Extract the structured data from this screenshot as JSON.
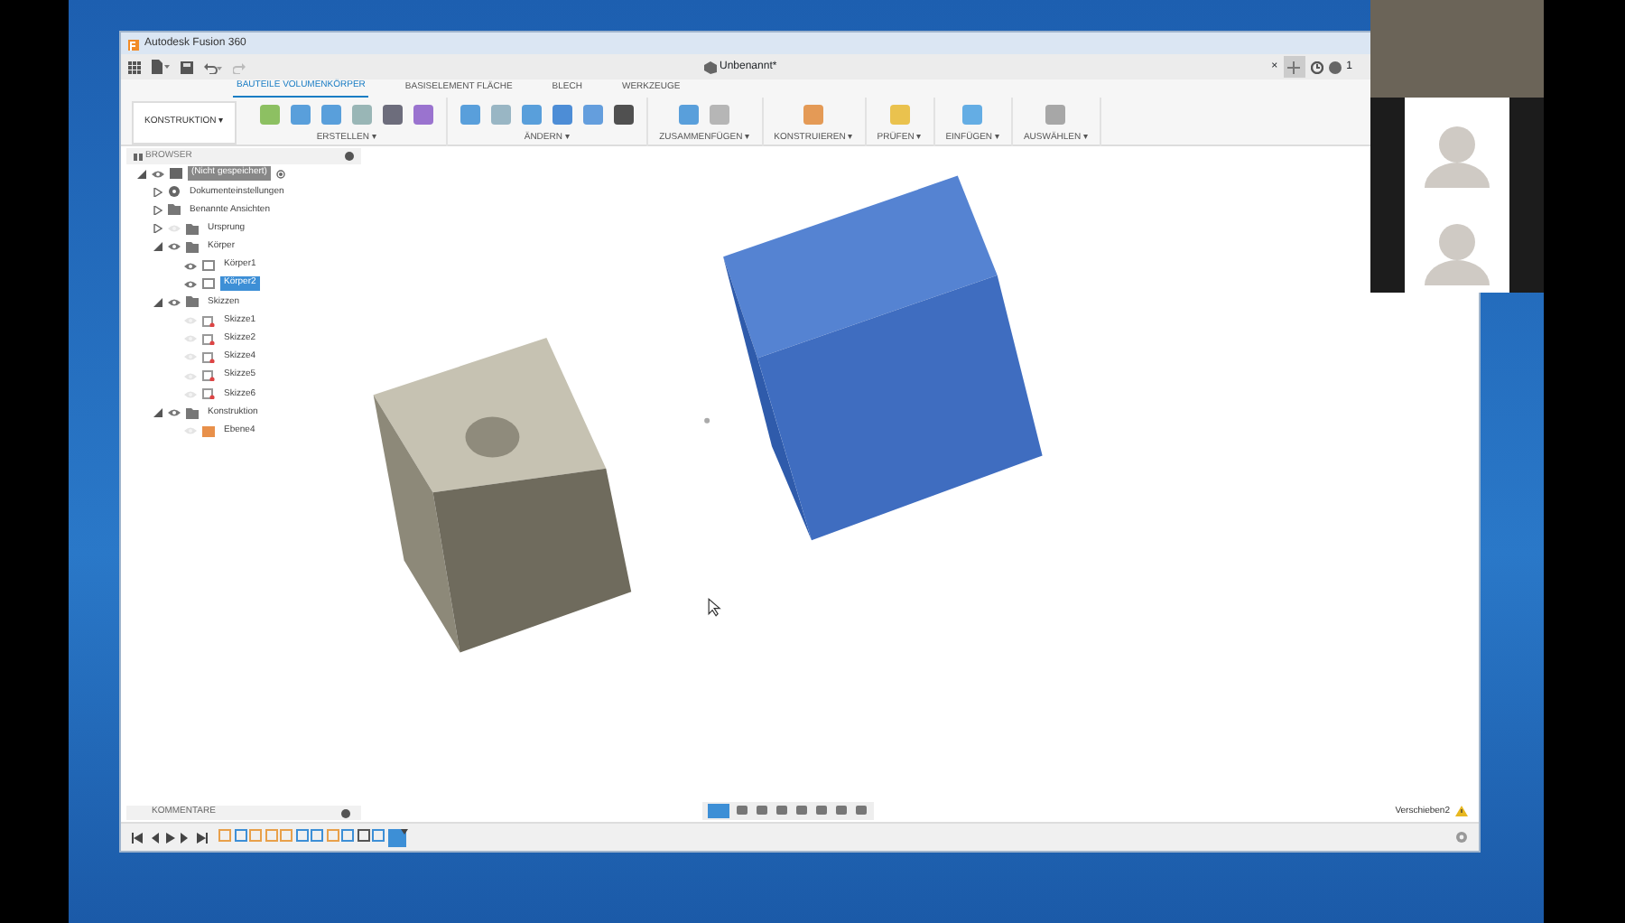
{
  "window": {
    "title": "Autodesk Fusion 360"
  },
  "document": {
    "title": "Unbenannt*",
    "close": "×",
    "notifications": "1"
  },
  "workspace": {
    "label": "KONSTRUKTION ▾"
  },
  "tabs": [
    {
      "label": "BAUTEILE VOLUMENKÖRPER",
      "selected": true
    },
    {
      "label": "BASISELEMENT FLÄCHE",
      "selected": false
    },
    {
      "label": "BLECH",
      "selected": false
    },
    {
      "label": "WERKZEUGE",
      "selected": false
    }
  ],
  "tool_groups": [
    {
      "label": "ERSTELLEN ▾"
    },
    {
      "label": "ÄNDERN ▾"
    },
    {
      "label": "ZUSAMMENFÜGEN ▾"
    },
    {
      "label": "KONSTRUIEREN ▾"
    },
    {
      "label": "PRÜFEN ▾"
    },
    {
      "label": "EINFÜGEN ▾"
    },
    {
      "label": "AUSWÄHLEN ▾"
    }
  ],
  "browser": {
    "title": "BROWSER",
    "tree": [
      {
        "label": "(Nicht gespeichert)",
        "kind": "component",
        "visible": true,
        "expanded": true,
        "selected": false,
        "children": [
          {
            "label": "Dokumenteinstellungen",
            "kind": "settings",
            "expanded": false,
            "selected": false
          },
          {
            "label": "Benannte Ansichten",
            "kind": "folder",
            "expanded": false,
            "selected": false
          },
          {
            "label": "Ursprung",
            "kind": "folder",
            "visible": false,
            "expanded": false,
            "selected": false
          },
          {
            "label": "Körper",
            "kind": "folder",
            "visible": true,
            "expanded": true,
            "selected": false,
            "children": [
              {
                "label": "Körper1",
                "kind": "body",
                "visible": true,
                "selected": false
              },
              {
                "label": "Körper2",
                "kind": "body",
                "visible": true,
                "selected": true
              }
            ]
          },
          {
            "label": "Skizzen",
            "kind": "folder",
            "visible": true,
            "expanded": true,
            "selected": false,
            "children": [
              {
                "label": "Skizze1",
                "kind": "sketch",
                "visible": false,
                "selected": false
              },
              {
                "label": "Skizze2",
                "kind": "sketch",
                "visible": false,
                "selected": false
              },
              {
                "label": "Skizze4",
                "kind": "sketch",
                "visible": false,
                "selected": false
              },
              {
                "label": "Skizze5",
                "kind": "sketch",
                "visible": false,
                "selected": false
              },
              {
                "label": "Skizze6",
                "kind": "sketch",
                "visible": false,
                "selected": false
              }
            ]
          },
          {
            "label": "Konstruktion",
            "kind": "folder",
            "visible": true,
            "expanded": true,
            "selected": false,
            "children": [
              {
                "label": "Ebene4",
                "kind": "plane",
                "visible": false,
                "selected": false
              }
            ]
          }
        ]
      }
    ]
  },
  "comments": {
    "title": "KOMMENTARE"
  },
  "status": {
    "text": "Verschieben2"
  },
  "participants": [
    {
      "kind": "video"
    },
    {
      "kind": "avatar"
    },
    {
      "kind": "avatar"
    }
  ]
}
